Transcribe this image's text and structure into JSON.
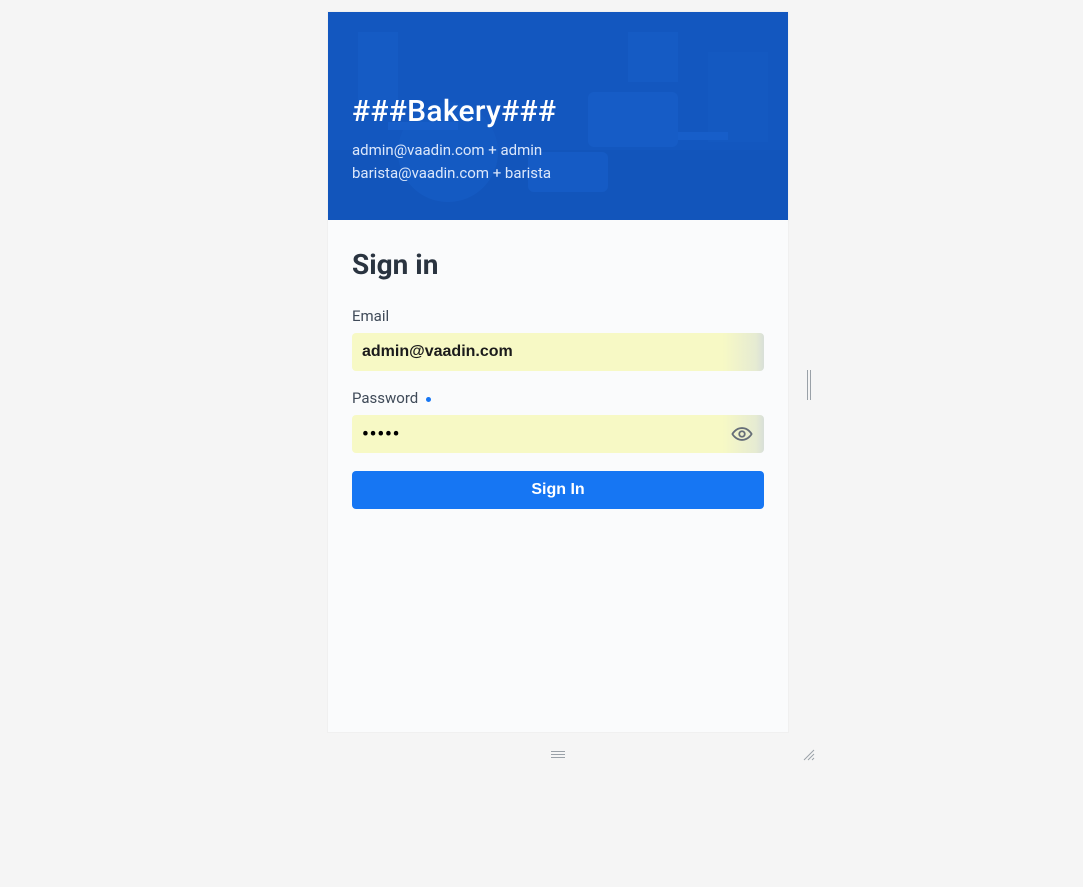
{
  "header": {
    "title": "###Bakery###",
    "hint_line1": "admin@vaadin.com + admin",
    "hint_line2": "barista@vaadin.com + barista"
  },
  "form": {
    "title": "Sign in",
    "email": {
      "label": "Email",
      "value": "admin@vaadin.com"
    },
    "password": {
      "label": "Password",
      "value_masked": "•••••"
    },
    "submit_label": "Sign In"
  },
  "icons": {
    "eye": "eye-icon"
  }
}
